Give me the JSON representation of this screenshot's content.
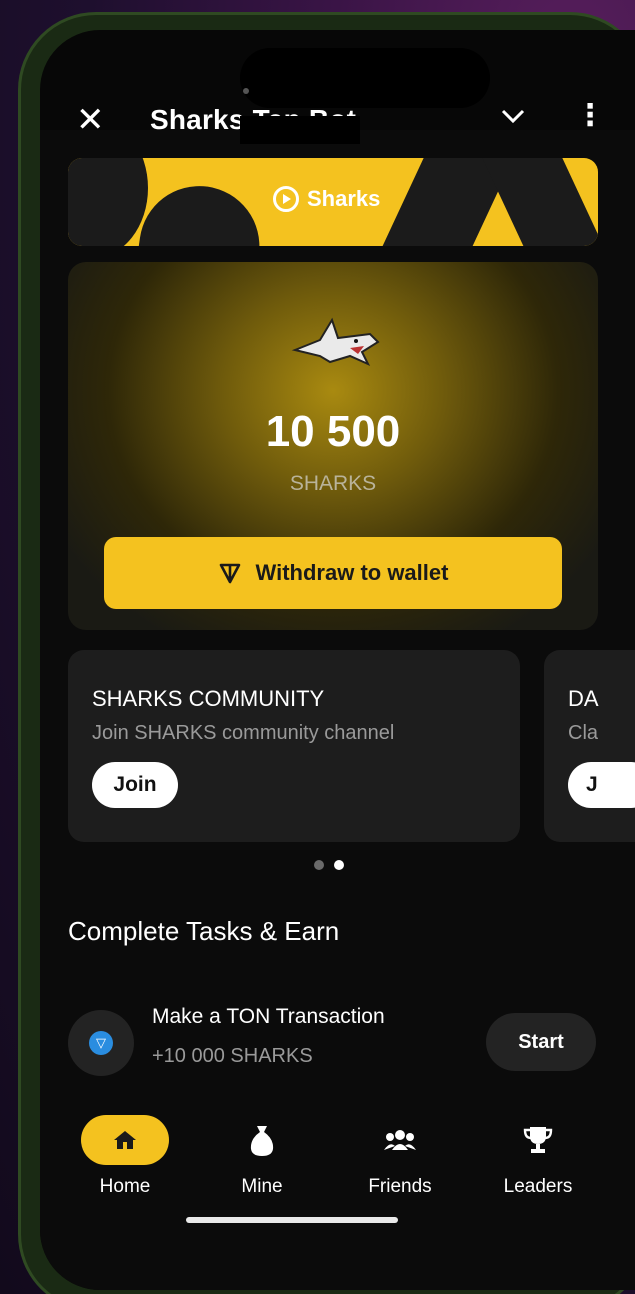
{
  "topbar": {
    "title": "Sharks Tap Bot",
    "close_icon": "close-icon",
    "collapse_icon": "chevron-down-icon",
    "menu_icon": "more-vertical-icon"
  },
  "banner": {
    "label": "Sharks",
    "icon": "play-ring-icon"
  },
  "balance": {
    "amount": "10 500",
    "unit": "SHARKS",
    "icon": "shark-logo",
    "withdraw_label": "Withdraw to wallet",
    "withdraw_icon": "ton-icon"
  },
  "promo_cards": [
    {
      "title": "SHARKS COMMUNITY",
      "subtitle": "Join SHARKS community channel",
      "button": "Join"
    },
    {
      "title": "DA",
      "subtitle": "Cla",
      "button": "J"
    }
  ],
  "carousel": {
    "count": 2,
    "active_index": 1
  },
  "tasks": {
    "section_title": "Complete Tasks & Earn",
    "items": [
      {
        "title": "Make a TON Transaction",
        "reward": "+10 000 SHARKS",
        "button": "Start",
        "icon": "ton-icon"
      }
    ]
  },
  "nav": {
    "items": [
      {
        "label": "Home",
        "icon": "home-icon",
        "active": true
      },
      {
        "label": "Mine",
        "icon": "money-bag-icon",
        "active": false
      },
      {
        "label": "Friends",
        "icon": "friends-icon",
        "active": false
      },
      {
        "label": "Leaders",
        "icon": "trophy-icon",
        "active": false
      }
    ]
  },
  "colors": {
    "accent": "#f4c21f",
    "background": "#0b0b0b",
    "card": "#1d1d1d"
  }
}
